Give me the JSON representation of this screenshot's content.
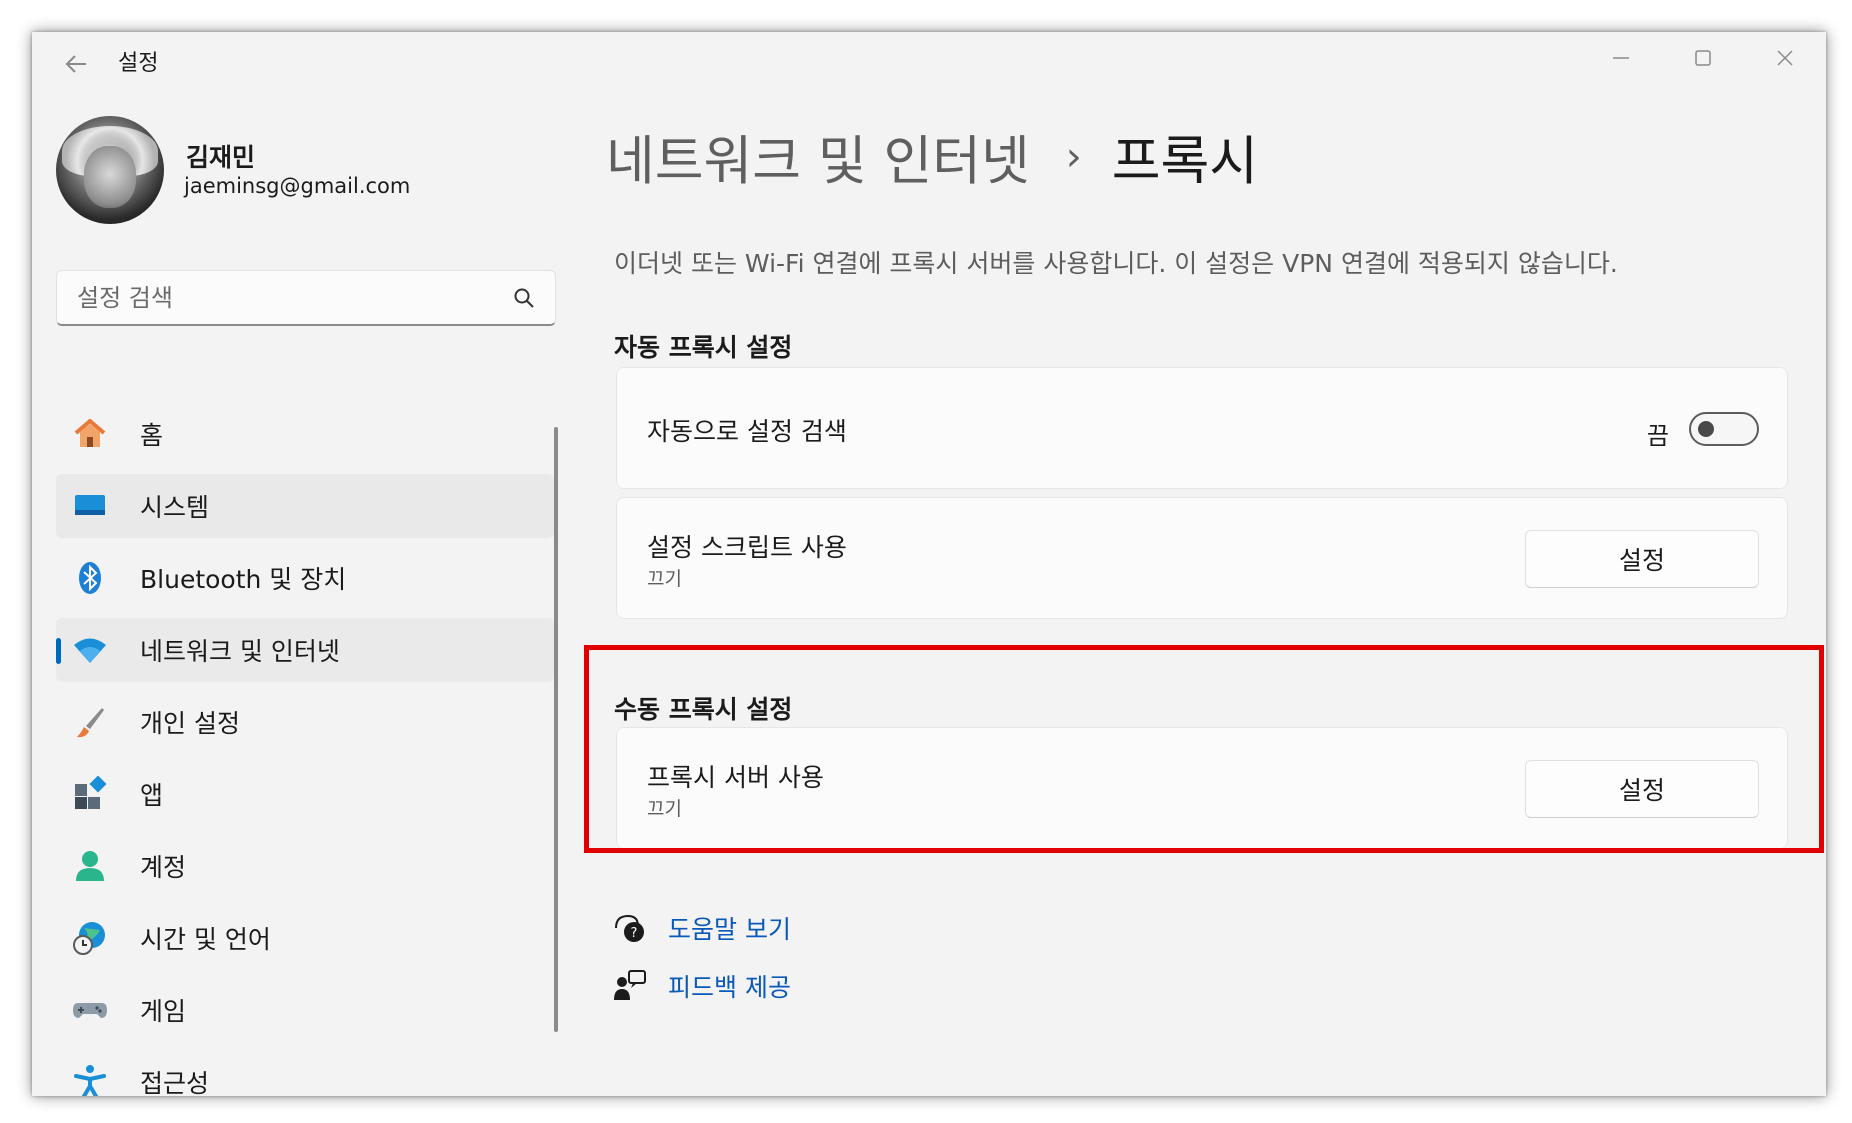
{
  "window": {
    "title": "설정",
    "back_label": "←"
  },
  "profile": {
    "name": "김재민",
    "email": "jaeminsg@gmail.com"
  },
  "search": {
    "placeholder": "설정 검색"
  },
  "sidebar": {
    "items": [
      {
        "label": "홈",
        "icon": "home-icon"
      },
      {
        "label": "시스템",
        "icon": "system-icon"
      },
      {
        "label": "Bluetooth 및 장치",
        "icon": "bluetooth-icon"
      },
      {
        "label": "네트워크 및 인터넷",
        "icon": "wifi-icon",
        "selected": true
      },
      {
        "label": "개인 설정",
        "icon": "brush-icon"
      },
      {
        "label": "앱",
        "icon": "apps-icon"
      },
      {
        "label": "계정",
        "icon": "account-icon"
      },
      {
        "label": "시간 및 언어",
        "icon": "globe-clock-icon"
      },
      {
        "label": "게임",
        "icon": "gamepad-icon"
      },
      {
        "label": "접근성",
        "icon": "accessibility-icon"
      }
    ]
  },
  "header": {
    "parent": "네트워크 및 인터넷",
    "separator": "›",
    "current": "프록시",
    "description": "이더넷 또는 Wi-Fi 연결에 프록시 서버를 사용합니다. 이 설정은 VPN 연결에 적용되지 않습니다."
  },
  "auto_proxy": {
    "section_title": "자동 프록시 설정",
    "detect": {
      "label": "자동으로 설정 검색",
      "state_text": "끔",
      "on": false
    },
    "script": {
      "label": "설정 스크립트 사용",
      "status": "끄기",
      "button": "설정"
    }
  },
  "manual_proxy": {
    "section_title": "수동 프록시 설정",
    "server": {
      "label": "프록시 서버 사용",
      "status": "끄기",
      "button": "설정"
    }
  },
  "links": {
    "help": "도움말 보기",
    "feedback": "피드백 제공"
  },
  "colors": {
    "accent": "#0067c0",
    "link": "#0a58b8",
    "highlight": "#e00000"
  }
}
